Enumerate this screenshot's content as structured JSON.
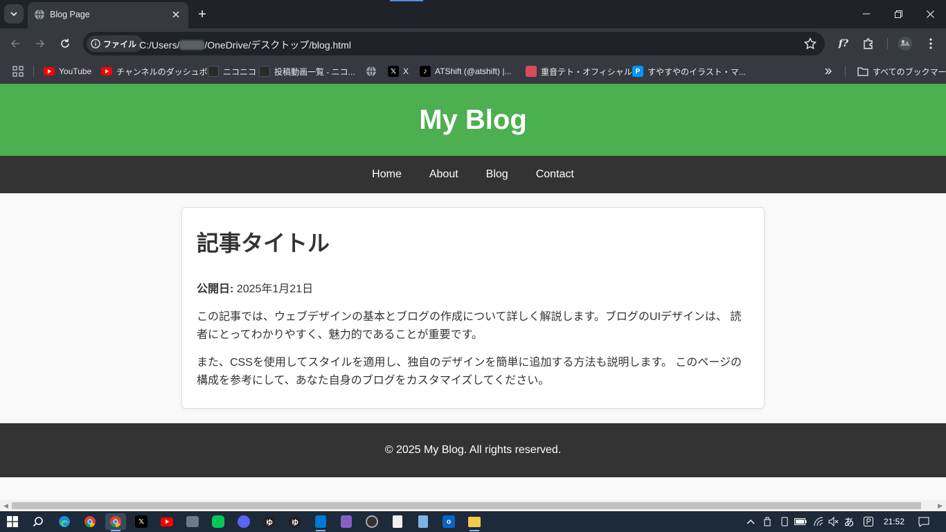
{
  "browser": {
    "tab_title": "Blog Page",
    "chip_label": "ファイル",
    "url_prefix": "C:/Users/",
    "url_suffix": "/OneDrive/デスクトップ/blog.html",
    "bookmarks": [
      {
        "label": "YouTube",
        "icon": "youtube-icon"
      },
      {
        "label": "チャンネルのダッシュボ...",
        "icon": "youtube-icon"
      },
      {
        "label": "ニコニコ",
        "icon": "niconico-icon"
      },
      {
        "label": "投稿動画一覧 - ニコ...",
        "icon": "niconico-icon"
      },
      {
        "label": "",
        "icon": "globe-icon"
      },
      {
        "label": "X",
        "icon": "x-icon"
      },
      {
        "label": "ATShift (@atshift) |...",
        "icon": "tiktok-icon"
      },
      {
        "label": "重音テト・オフィシャル...",
        "icon": "teto-icon"
      },
      {
        "label": "すやすやのイラスト・マ...",
        "icon": "pixiv-icon"
      }
    ],
    "all_bookmarks_label": "すべてのブックマーク",
    "extension_label": "f?"
  },
  "site": {
    "title": "My Blog",
    "nav": [
      "Home",
      "About",
      "Blog",
      "Contact"
    ],
    "article": {
      "heading": "記事タイトル",
      "date_label": "公開日:",
      "date_value": "2025年1月21日",
      "paragraphs": [
        "この記事では、ウェブデザインの基本とブログの作成について詳しく解説します。ブログのUIデザインは、 読者にとってわかりやすく、魅力的であることが重要です。",
        "また、CSSを使用してスタイルを適用し、独自のデザインを簡単に追加する方法も説明します。 このページの構成を参考にして、あなた自身のブログをカスタマイズしてください。"
      ]
    },
    "footer": "© 2025 My Blog. All rights reserved."
  },
  "taskbar": {
    "ime_label": "あ",
    "time": "21:52"
  },
  "colors": {
    "header_green": "#4caf50",
    "nav_dark": "#333333",
    "chrome_dark": "#1f2329"
  }
}
